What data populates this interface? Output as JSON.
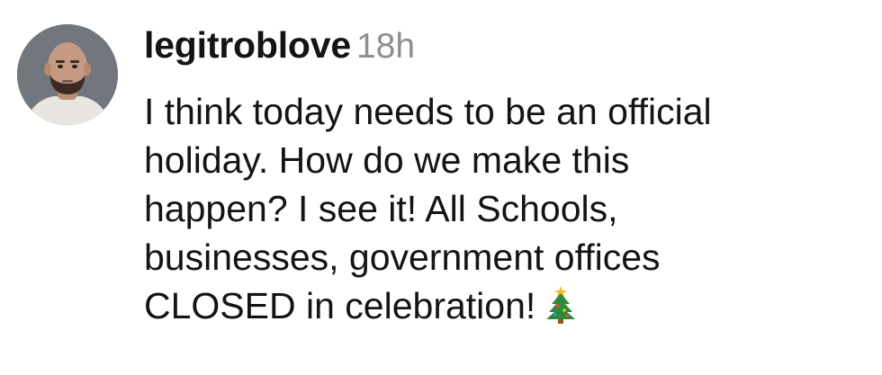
{
  "comment": {
    "username": "legitroblove",
    "timestamp": "18h",
    "text_lines": [
      "I think today needs to be an official",
      "holiday. How do we make this",
      "happen? I see it! All Schools,",
      "businesses, government offices",
      "CLOSED in celebration!"
    ],
    "emoji": "christmas-tree-icon"
  },
  "colors": {
    "text": "#141414",
    "timestamp": "#8e8e8e",
    "background": "#ffffff"
  }
}
